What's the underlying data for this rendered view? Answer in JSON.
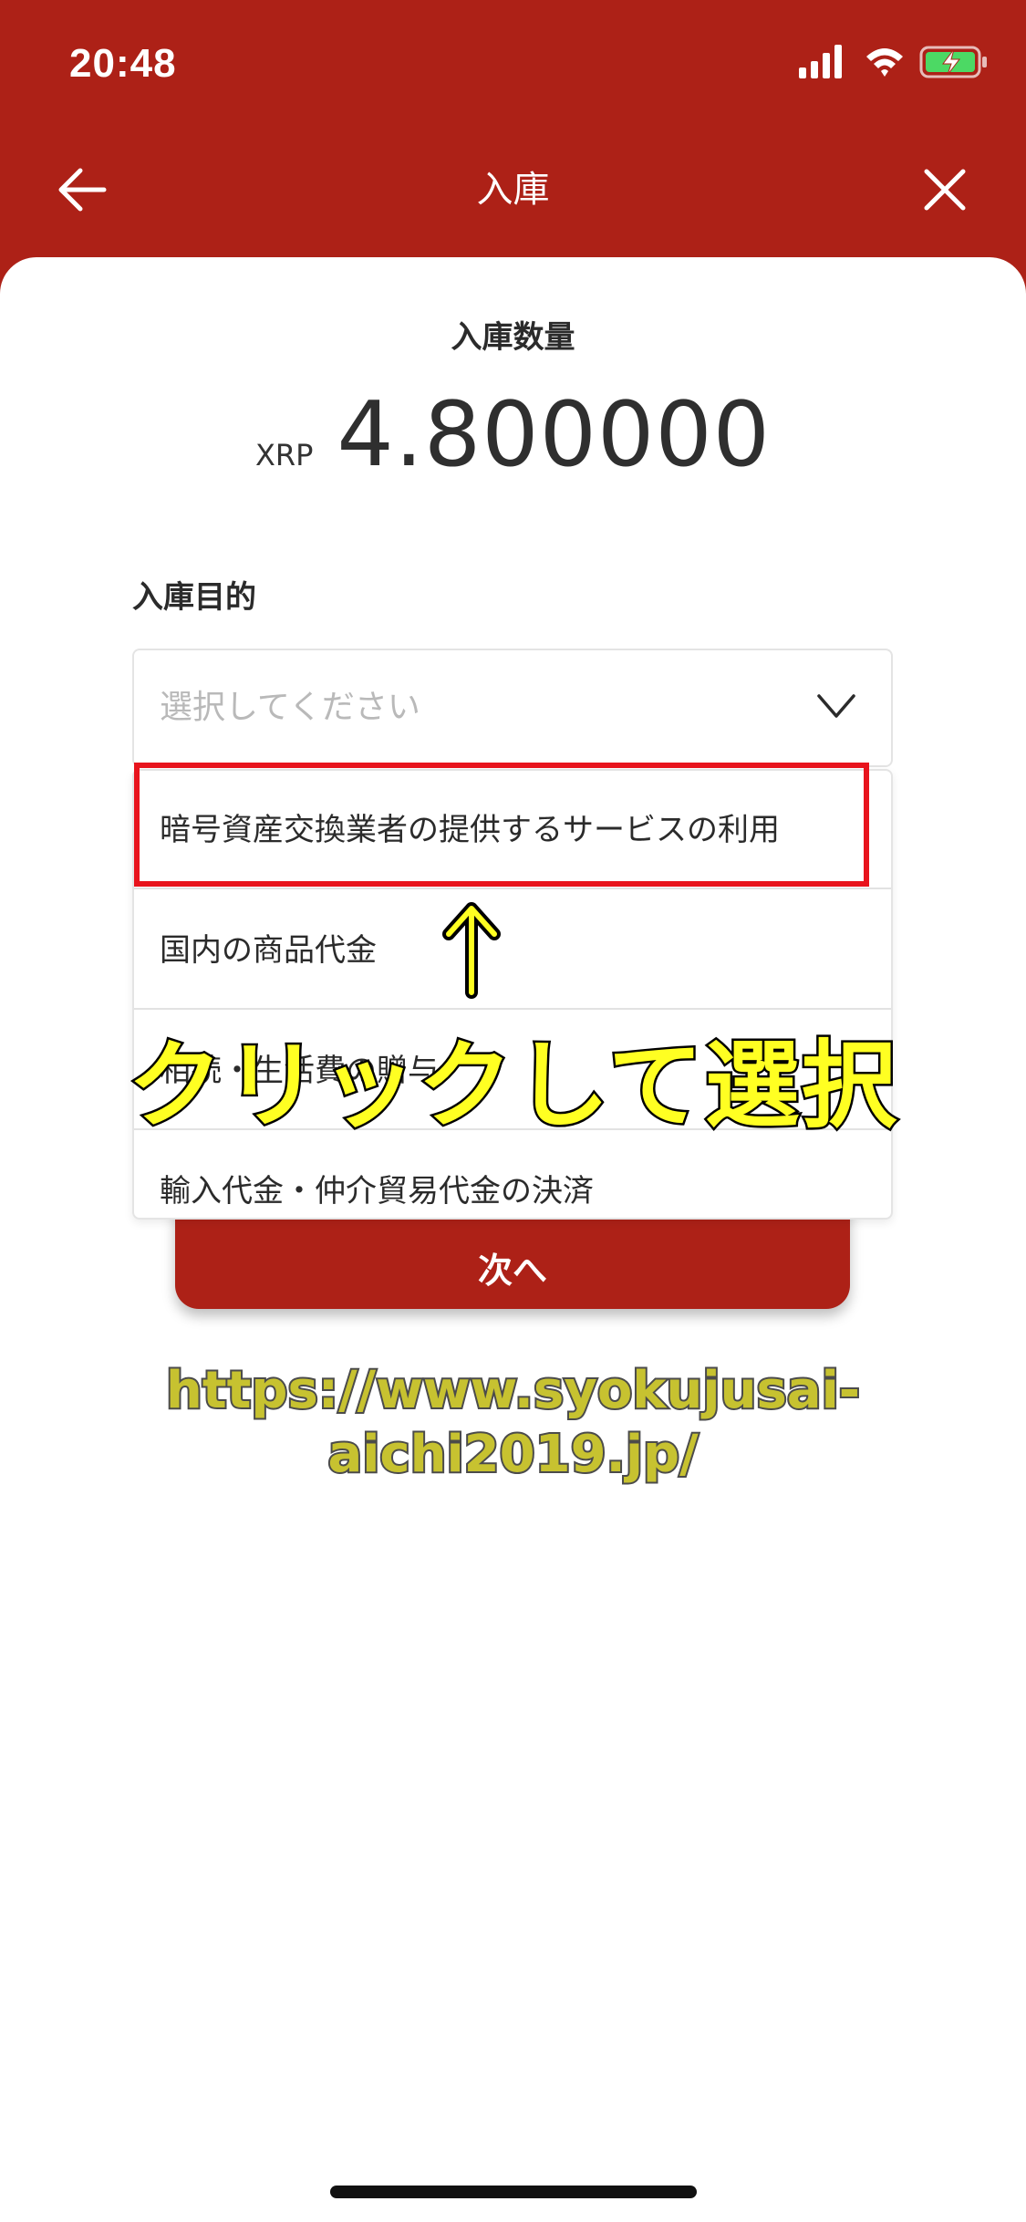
{
  "status_bar": {
    "time": "20:48"
  },
  "header": {
    "title": "入庫"
  },
  "quantity": {
    "label": "入庫数量",
    "unit": "XRP",
    "value": "4.800000"
  },
  "purpose": {
    "label": "入庫目的",
    "placeholder": "選択してください",
    "options": [
      "暗号資産交換業者の提供するサービスの利用",
      "国内の商品代金",
      "相続・生活費の贈与",
      "輸入代金・仲介貿易代金の決済"
    ]
  },
  "next_button": {
    "label": "次へ"
  },
  "annotation": {
    "text": "クリックして選択"
  },
  "watermark": {
    "text": "https://www.syokujusai-aichi2019.jp/"
  },
  "colors": {
    "brand_red": "#ad2117",
    "highlight_red": "#e8141d",
    "annotation_yellow": "#ffff22"
  },
  "icons": [
    "back-arrow-icon",
    "close-icon",
    "chevron-down-icon",
    "signal-icon",
    "wifi-icon",
    "battery-icon",
    "up-arrow-icon"
  ]
}
